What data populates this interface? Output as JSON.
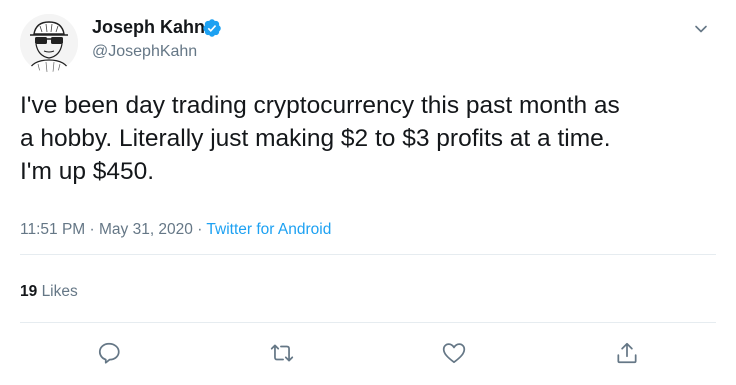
{
  "user": {
    "name": "Joseph Kahn",
    "handle": "@JosephKahn",
    "verified": true
  },
  "tweet": {
    "lines": [
      "I've been day trading cryptocurrency this past month as",
      "a hobby. Literally just making $2 to $3 profits at a time.",
      "I'm up $450."
    ],
    "time": "11:51 PM",
    "separator": " · ",
    "date": "May 31, 2020",
    "source": "Twitter for Android"
  },
  "stats": {
    "likes_count": "19",
    "likes_label": "Likes"
  },
  "icons": {
    "verified": "verified-badge-icon",
    "caret": "chevron-down-icon",
    "reply": "reply-icon",
    "retweet": "retweet-icon",
    "like": "heart-icon",
    "share": "share-icon"
  },
  "colors": {
    "text": "#14171a",
    "secondary": "#657786",
    "accent": "#1da1f2",
    "divider": "#e6ecf0"
  }
}
